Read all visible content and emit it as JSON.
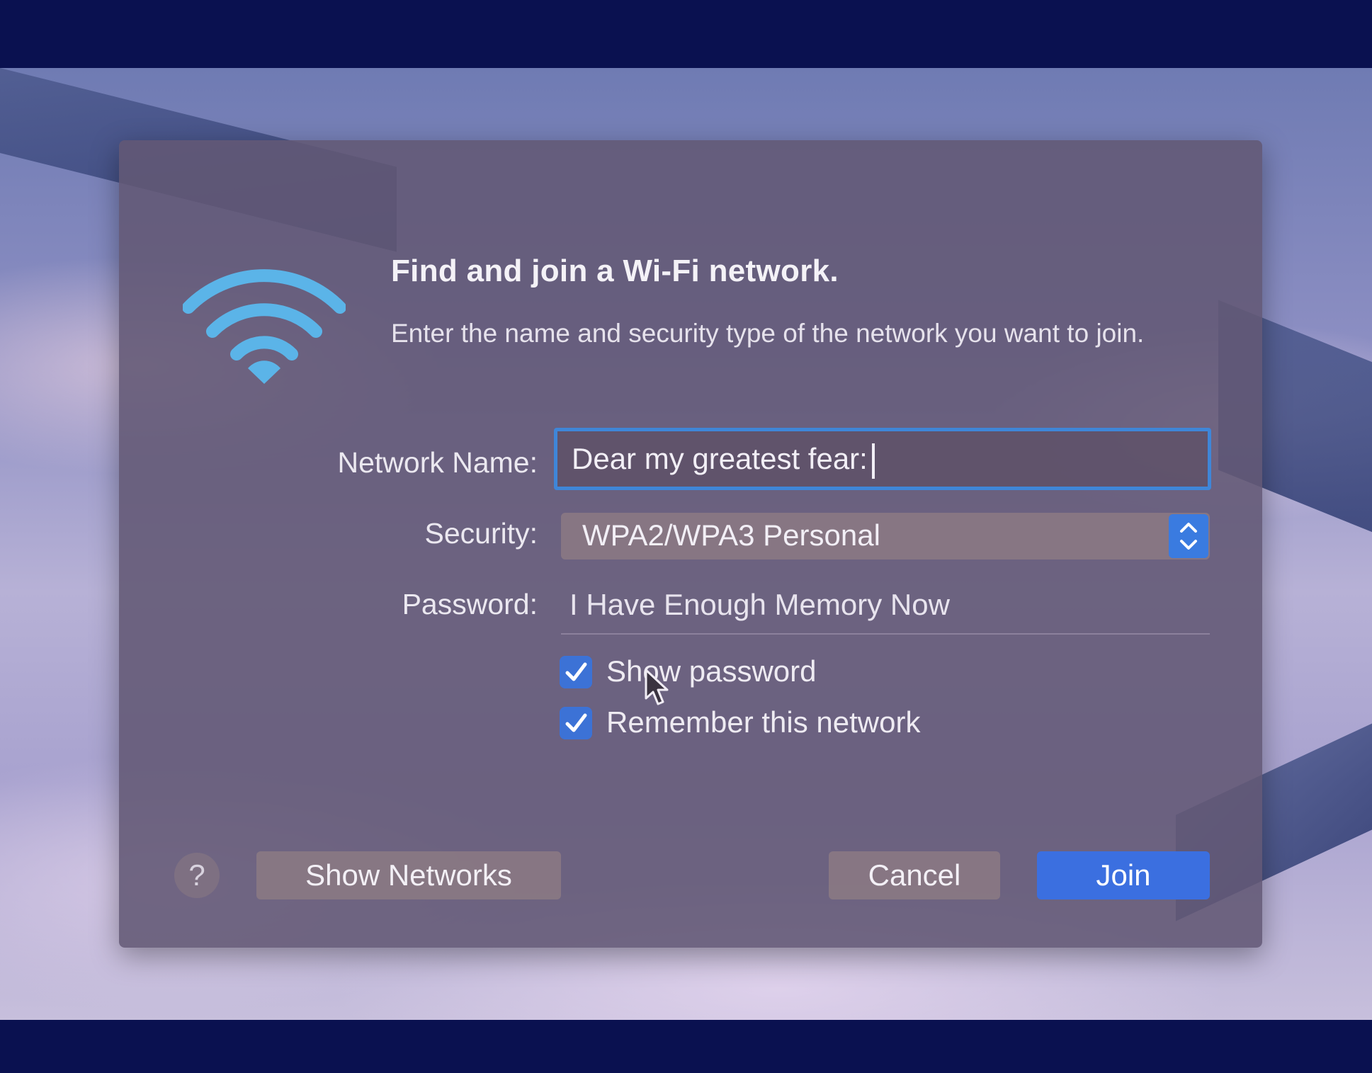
{
  "dialog": {
    "title": "Find and join a Wi-Fi network.",
    "subtitle": "Enter the name and security type of the network you want to join.",
    "icon": "wifi-icon"
  },
  "fields": {
    "network_name_label": "Network Name:",
    "network_name_value": "Dear my greatest fear:",
    "security_label": "Security:",
    "security_value": "WPA2/WPA3 Personal",
    "password_label": "Password:",
    "password_value": "I Have Enough Memory Now"
  },
  "options": {
    "show_password_label": "Show password",
    "show_password_checked": true,
    "remember_label": "Remember this network",
    "remember_checked": true
  },
  "buttons": {
    "help_label": "?",
    "show_networks_label": "Show Networks",
    "cancel_label": "Cancel",
    "join_label": "Join"
  },
  "colors": {
    "accent": "#3b6fe0",
    "focus_ring": "#3f86d8",
    "wifi_icon": "#5bb4e8",
    "letterbox": "#0a1150"
  }
}
